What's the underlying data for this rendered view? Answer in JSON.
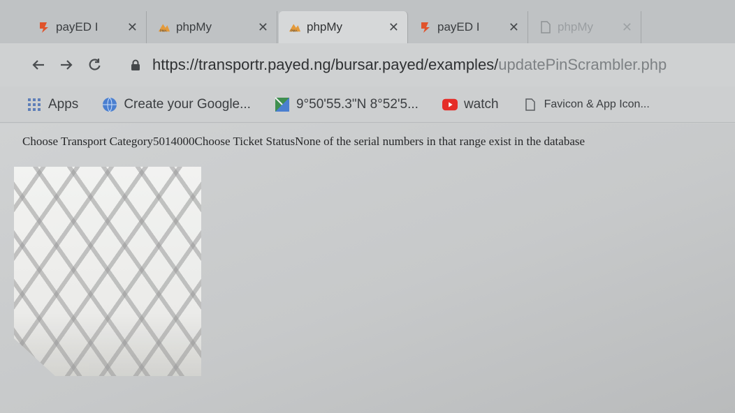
{
  "tabs": [
    {
      "title": "payED I",
      "icon": "payed-logo-icon",
      "state": "inactive"
    },
    {
      "title": "phpMy",
      "icon": "phpmyadmin-icon",
      "state": "inactive"
    },
    {
      "title": "phpMy",
      "icon": "phpmyadmin-icon",
      "state": "active"
    },
    {
      "title": "payED I",
      "icon": "payed-logo-icon",
      "state": "inactive"
    },
    {
      "title": "phpMy",
      "icon": "page-icon",
      "state": "faded"
    }
  ],
  "toolbar": {
    "url_main": "https://transportr.payed.ng/bursar.payed/examples/",
    "url_tail": "updatePinScrambler.php"
  },
  "bookmarks": [
    {
      "label": "Apps",
      "icon": "apps-grid-icon"
    },
    {
      "label": "Create your Google...",
      "icon": "globe-icon"
    },
    {
      "label": "9°50'55.3\"N 8°52'5...",
      "icon": "maps-icon"
    },
    {
      "label": "watch",
      "icon": "youtube-icon"
    },
    {
      "label": "Favicon & App Icon...",
      "icon": "page-icon"
    }
  ],
  "content": {
    "status_text": "Choose Transport Category5014000Choose Ticket StatusNone of the serial numbers in that range exist in the database"
  },
  "colors": {
    "payed_orange": "#e0532b",
    "youtube_red": "#e52d27",
    "globe_blue": "#4a7fd0"
  }
}
